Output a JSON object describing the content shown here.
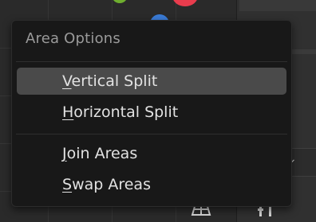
{
  "menu": {
    "title": "Area Options",
    "items": [
      {
        "label": "Vertical Split",
        "active": true
      },
      {
        "label": "Horizontal Split",
        "active": false
      },
      {
        "label": "Join Areas",
        "active": false
      },
      {
        "label": "Swap Areas",
        "active": false
      }
    ]
  },
  "colors": {
    "gizmo_green": "#6fae2f",
    "gizmo_red": "#e83c4d",
    "gizmo_blue": "#3a7bd5"
  },
  "icons": {
    "viewport_grid": "grid-icon",
    "properties_tool": "tool-settings-icon",
    "dropdown": "chevron-down-icon"
  }
}
